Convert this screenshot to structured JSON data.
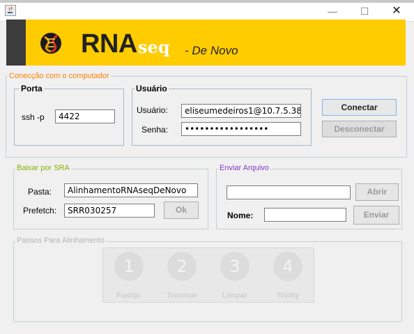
{
  "window": {
    "minimize_glyph": "—",
    "maximize_glyph": "☐",
    "close_glyph": "✕"
  },
  "banner": {
    "app_name": "RNA",
    "app_suffix": "seq",
    "subtitle": "- De Novo",
    "logo_icon": "dna-helix-icon",
    "colors": {
      "banner": "#ffcc00",
      "side": "#3c3c3c",
      "suffix": "#ffffff"
    }
  },
  "connection": {
    "group_title": "Conecção com o computador",
    "group_title_color": "#ff8000",
    "port": {
      "title": "Porta",
      "label": "ssh -p",
      "value": "4422"
    },
    "user": {
      "title": "Usuário",
      "user_label": "Usuário:",
      "user_value": "eliseumedeiros1@10.7.5.38",
      "password_label": "Senha:",
      "password_value": "•••••••••••••••••"
    },
    "connect_label": "Conectar",
    "disconnect_label": "Desconectar"
  },
  "sra": {
    "group_title": "Baixar por SRA",
    "group_title_color": "#88b000",
    "folder_label": "Pasta:",
    "folder_value": "AlinhamentoRNAseqDeNovo",
    "prefetch_label": "Prefetch:",
    "prefetch_value": "SRR030257",
    "ok_label": "Ok"
  },
  "send": {
    "group_title": "Enviar Arquivo",
    "group_title_color": "#7a3cc8",
    "file_value": "",
    "open_label": "Abrir",
    "name_label": "Nome:",
    "name_value": "",
    "send_label": "Enviar"
  },
  "steps": {
    "group_title": "Passos Para Alinhamento",
    "items": [
      {
        "number": "1",
        "label": "Fastqc"
      },
      {
        "number": "2",
        "label": "Trimmar"
      },
      {
        "number": "3",
        "label": "Limpar"
      },
      {
        "number": "4",
        "label": "Trinity"
      }
    ]
  }
}
